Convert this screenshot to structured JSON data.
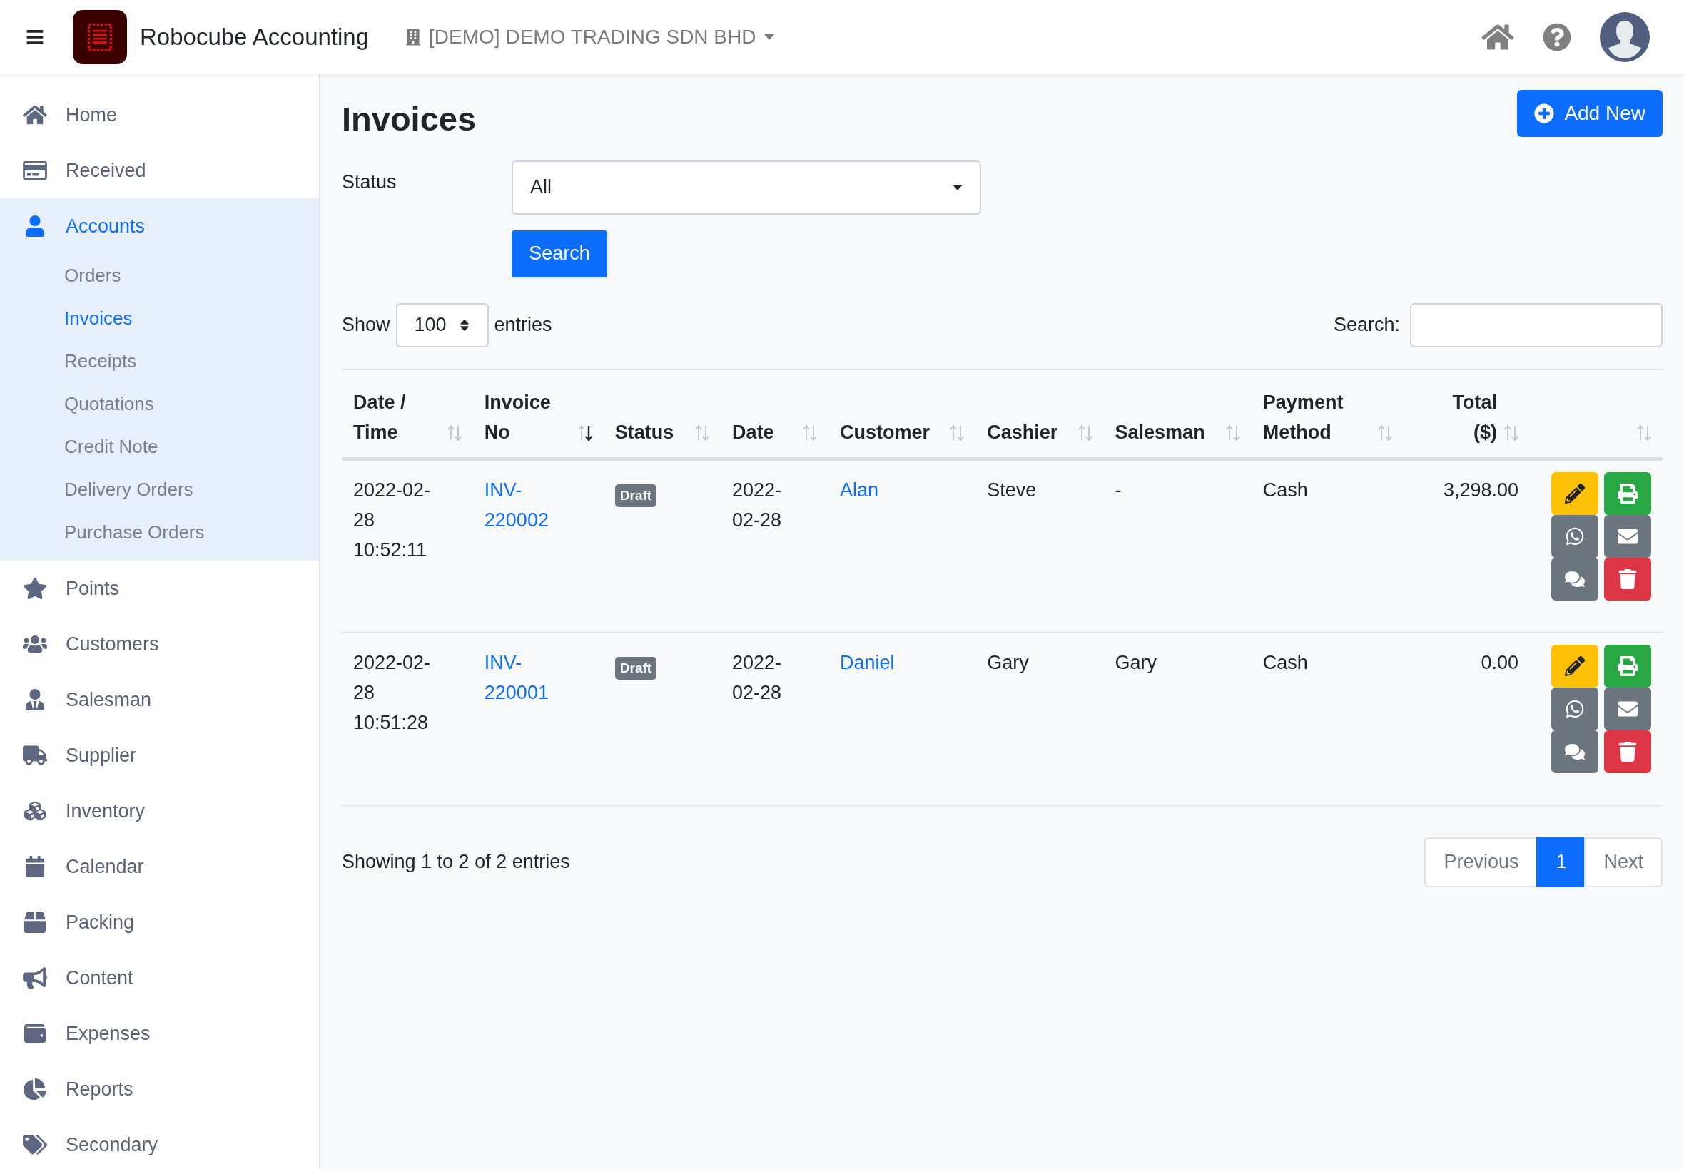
{
  "app": {
    "name": "Robocube Accounting",
    "company": "[DEMO] DEMO TRADING SDN BHD"
  },
  "sidebar": {
    "items": [
      {
        "label": "Home",
        "selected": false
      },
      {
        "label": "Received",
        "selected": false
      },
      {
        "label": "Accounts",
        "selected": true,
        "expanded": true,
        "children": [
          {
            "label": "Orders",
            "selected": false
          },
          {
            "label": "Invoices",
            "selected": true
          },
          {
            "label": "Receipts",
            "selected": false
          },
          {
            "label": "Quotations",
            "selected": false
          },
          {
            "label": "Credit Note",
            "selected": false
          },
          {
            "label": "Delivery Orders",
            "selected": false
          },
          {
            "label": "Purchase Orders",
            "selected": false
          }
        ]
      },
      {
        "label": "Points",
        "selected": false
      },
      {
        "label": "Customers",
        "selected": false
      },
      {
        "label": "Salesman",
        "selected": false
      },
      {
        "label": "Supplier",
        "selected": false
      },
      {
        "label": "Inventory",
        "selected": false
      },
      {
        "label": "Calendar",
        "selected": false
      },
      {
        "label": "Packing",
        "selected": false
      },
      {
        "label": "Content",
        "selected": false
      },
      {
        "label": "Expenses",
        "selected": false
      },
      {
        "label": "Reports",
        "selected": false
      },
      {
        "label": "Secondary",
        "selected": false
      }
    ]
  },
  "page": {
    "title": "Invoices",
    "add_button": "Add New"
  },
  "filter": {
    "label": "Status",
    "value": "All",
    "search_button": "Search"
  },
  "table_controls": {
    "show_label": "Show",
    "page_size": "100",
    "entries_label": "entries",
    "search_label": "Search:"
  },
  "table": {
    "columns": [
      {
        "label": "Date / Time",
        "sorted": false
      },
      {
        "label": "Invoice No",
        "sorted": true
      },
      {
        "label": "Status",
        "sorted": false
      },
      {
        "label": "Date",
        "sorted": false
      },
      {
        "label": "Customer",
        "sorted": false
      },
      {
        "label": "Cashier",
        "sorted": false
      },
      {
        "label": "Salesman",
        "sorted": false
      },
      {
        "label": "Payment Method",
        "sorted": false
      },
      {
        "label": "Total ($)",
        "sorted": false
      },
      {
        "sorted": false
      }
    ],
    "rows": [
      {
        "date_time": "2022-02-28 10:52:11",
        "invoice_no": "INV-220002",
        "status": "Draft",
        "date": "2022-02-28",
        "customer": "Alan",
        "cashier": "Steve",
        "salesman": "-",
        "payment_method": "Cash",
        "total": "3,298.00"
      },
      {
        "date_time": "2022-02-28 10:51:28",
        "invoice_no": "INV-220001",
        "status": "Draft",
        "date": "2022-02-28",
        "customer": "Daniel",
        "cashier": "Gary",
        "salesman": "Gary",
        "payment_method": "Cash",
        "total": "0.00"
      }
    ]
  },
  "footer": {
    "info": "Showing 1 to 2 of 2 entries",
    "pagination": [
      {
        "label": "Previous",
        "selected": false
      },
      {
        "label": "1",
        "selected": true
      },
      {
        "label": "Next",
        "selected": false
      }
    ]
  }
}
